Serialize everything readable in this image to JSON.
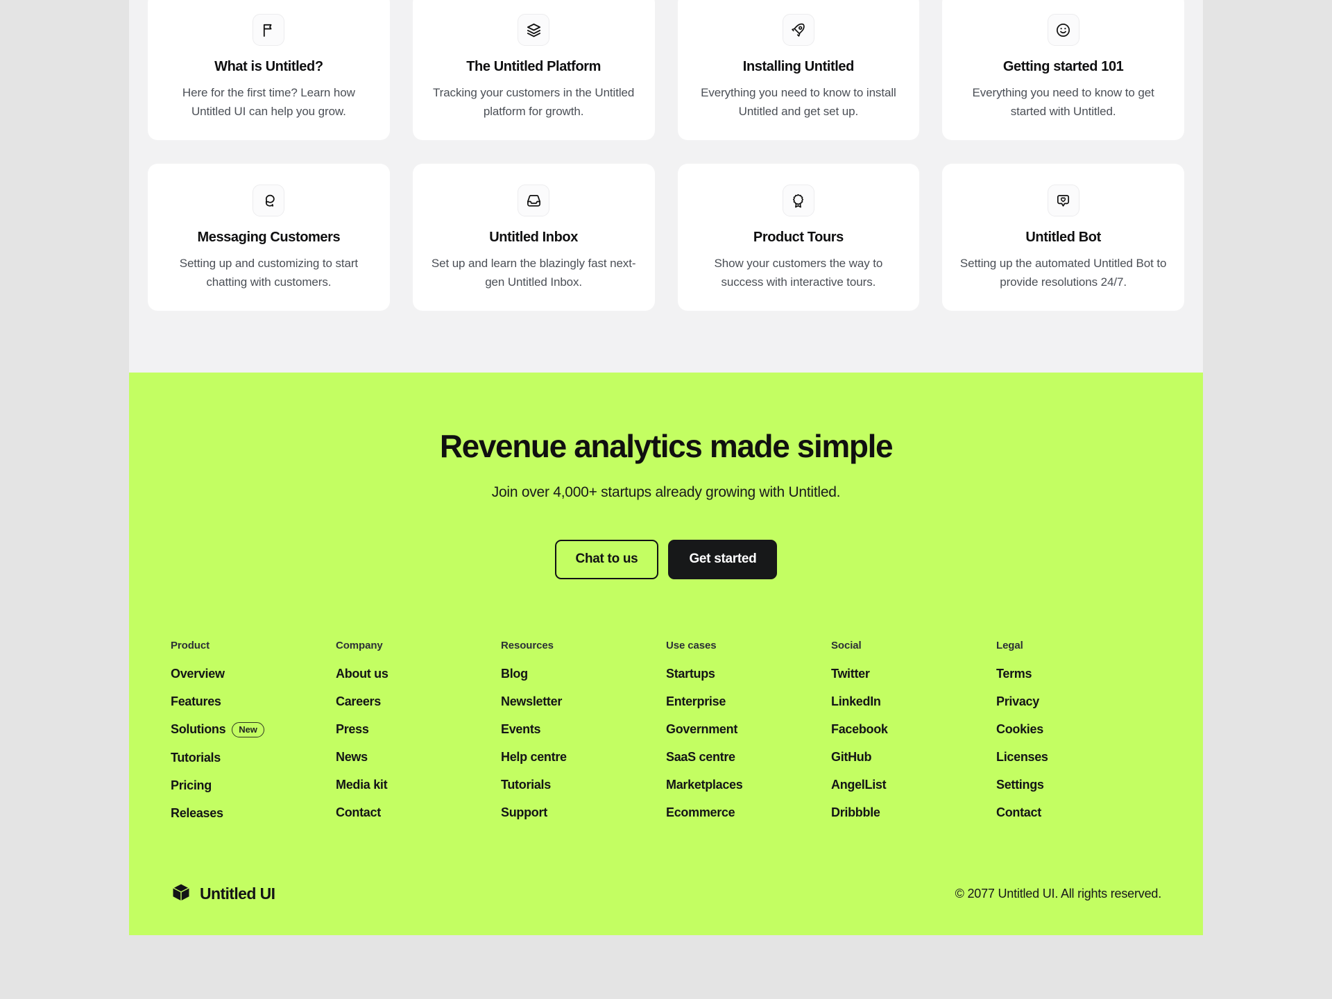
{
  "theme": {
    "accent_green": "#C3FE62",
    "page_bg": "#F2F2F3",
    "outer_bg": "#E4E4E4",
    "card_bg": "#FFFFFF",
    "dark": "#171819"
  },
  "cards": [
    {
      "icon": "flag-icon",
      "title": "What is Untitled?",
      "desc": "Here for the first time? Learn how Untitled UI can help you grow."
    },
    {
      "icon": "layers-icon",
      "title": "The Untitled Platform",
      "desc": "Tracking your customers in the Untitled platform for growth."
    },
    {
      "icon": "rocket-icon",
      "title": "Installing Untitled",
      "desc": "Everything you need to know to install Untitled and get set up."
    },
    {
      "icon": "smiley-icon",
      "title": "Getting started 101",
      "desc": "Everything you need to know to get started with Untitled."
    },
    {
      "icon": "message-chat-icon",
      "title": "Messaging Customers",
      "desc": "Setting up and customizing to start chatting with customers."
    },
    {
      "icon": "inbox-icon",
      "title": "Untitled Inbox",
      "desc": "Set up and learn the blazingly fast next-gen Untitled Inbox."
    },
    {
      "icon": "award-icon",
      "title": "Product Tours",
      "desc": "Show your customers the way to success with interactive tours."
    },
    {
      "icon": "message-heart-icon",
      "title": "Untitled Bot",
      "desc": "Setting up the automated Untitled Bot to provide resolutions 24/7."
    }
  ],
  "cta": {
    "title": "Revenue analytics made simple",
    "subtitle": "Join over 4,000+ startups already growing with Untitled.",
    "secondary_button": "Chat to us",
    "primary_button": "Get started"
  },
  "footer": {
    "columns": [
      {
        "heading": "Product",
        "links": [
          {
            "label": "Overview"
          },
          {
            "label": "Features"
          },
          {
            "label": "Solutions",
            "badge": "New"
          },
          {
            "label": "Tutorials"
          },
          {
            "label": "Pricing"
          },
          {
            "label": "Releases"
          }
        ]
      },
      {
        "heading": "Company",
        "links": [
          {
            "label": "About us"
          },
          {
            "label": "Careers"
          },
          {
            "label": "Press"
          },
          {
            "label": "News"
          },
          {
            "label": "Media kit"
          },
          {
            "label": "Contact"
          }
        ]
      },
      {
        "heading": "Resources",
        "links": [
          {
            "label": "Blog"
          },
          {
            "label": "Newsletter"
          },
          {
            "label": "Events"
          },
          {
            "label": "Help centre"
          },
          {
            "label": "Tutorials"
          },
          {
            "label": "Support"
          }
        ]
      },
      {
        "heading": "Use cases",
        "links": [
          {
            "label": "Startups"
          },
          {
            "label": "Enterprise"
          },
          {
            "label": "Government"
          },
          {
            "label": "SaaS centre"
          },
          {
            "label": "Marketplaces"
          },
          {
            "label": "Ecommerce"
          }
        ]
      },
      {
        "heading": "Social",
        "links": [
          {
            "label": "Twitter"
          },
          {
            "label": "LinkedIn"
          },
          {
            "label": "Facebook"
          },
          {
            "label": "GitHub"
          },
          {
            "label": "AngelList"
          },
          {
            "label": "Dribbble"
          }
        ]
      },
      {
        "heading": "Legal",
        "links": [
          {
            "label": "Terms"
          },
          {
            "label": "Privacy"
          },
          {
            "label": "Cookies"
          },
          {
            "label": "Licenses"
          },
          {
            "label": "Settings"
          },
          {
            "label": "Contact"
          }
        ]
      }
    ],
    "brand": {
      "icon": "cube-logo-icon",
      "name": "Untitled UI"
    },
    "copyright": "© 2077 Untitled UI. All rights reserved."
  }
}
